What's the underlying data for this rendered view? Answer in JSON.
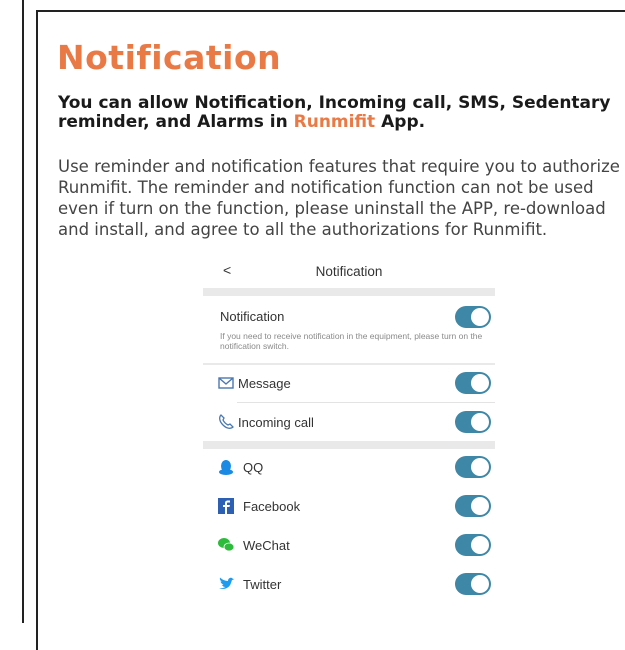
{
  "heading": {
    "title": "Notification",
    "subtitle_main": "You can allow Notification, Incoming call, SMS, Sedentary reminder, and Alarms in",
    "subtitle_app": "Runmifit",
    "subtitle_end": "App."
  },
  "body": {
    "paragraph": "Use reminder and notification features that require you to authorize Runmifit. The reminder and notification function can not be used even if turn on the function, please uninstall the APP, re-download and install, and agree to all the authorizations for Runmifit."
  },
  "phone": {
    "header": {
      "back": "<",
      "title": "Notification"
    },
    "notification": {
      "label": "Notification",
      "description": "If you need to receive notification in the equipment, please turn on the notification switch.",
      "enabled": true
    },
    "group1": [
      {
        "label": "Message",
        "icon": "envelope-icon",
        "enabled": true
      },
      {
        "label": "Incoming call",
        "icon": "phone-icon",
        "enabled": true
      }
    ],
    "group2": [
      {
        "label": "QQ",
        "icon": "qq-penguin-icon",
        "enabled": true
      },
      {
        "label": "Facebook",
        "icon": "facebook-icon",
        "enabled": true
      },
      {
        "label": "WeChat",
        "icon": "wechat-icon",
        "enabled": true
      },
      {
        "label": "Twitter",
        "icon": "twitter-bird-icon",
        "enabled": true
      }
    ]
  },
  "colors": {
    "accent": "#ea7a45",
    "toggle_on": "#3e87a6",
    "separator": "#e9e9e9"
  }
}
